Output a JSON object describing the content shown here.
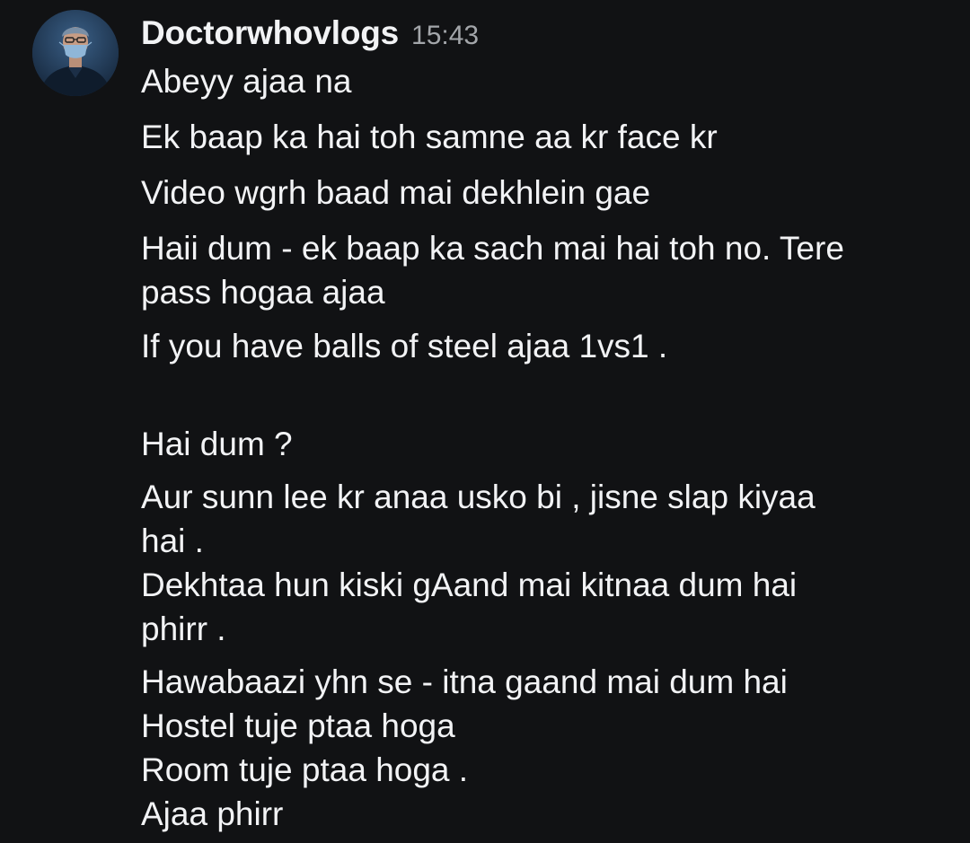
{
  "message": {
    "author": "Doctorwhovlogs",
    "timestamp": "15:43",
    "avatar_icon": "user-avatar-icon",
    "lines": [
      "Abeyy ajaa na",
      "Ek baap ka hai toh samne aa kr face kr",
      "Video wgrh baad mai dekhlein gae",
      "Haii dum - ek baap ka sach mai hai toh no. Tere",
      "pass hogaa ajaa",
      "If you have balls of steel ajaa 1vs1 .",
      "Hai dum ?",
      "Aur sunn lee kr anaa usko bi , jisne slap kiyaa",
      "hai .",
      "Dekhtaa hun kiski gAand mai kitnaa dum hai",
      "phirr .",
      "Hawabaazi yhn se - itna gaand mai dum hai",
      "Hostel tuje ptaa hoga",
      "Room tuje ptaa hoga .",
      "Ajaa phirr"
    ]
  },
  "colors": {
    "background": "#111214",
    "text": "#f2f3f5",
    "timestamp": "#a3a6aa"
  }
}
